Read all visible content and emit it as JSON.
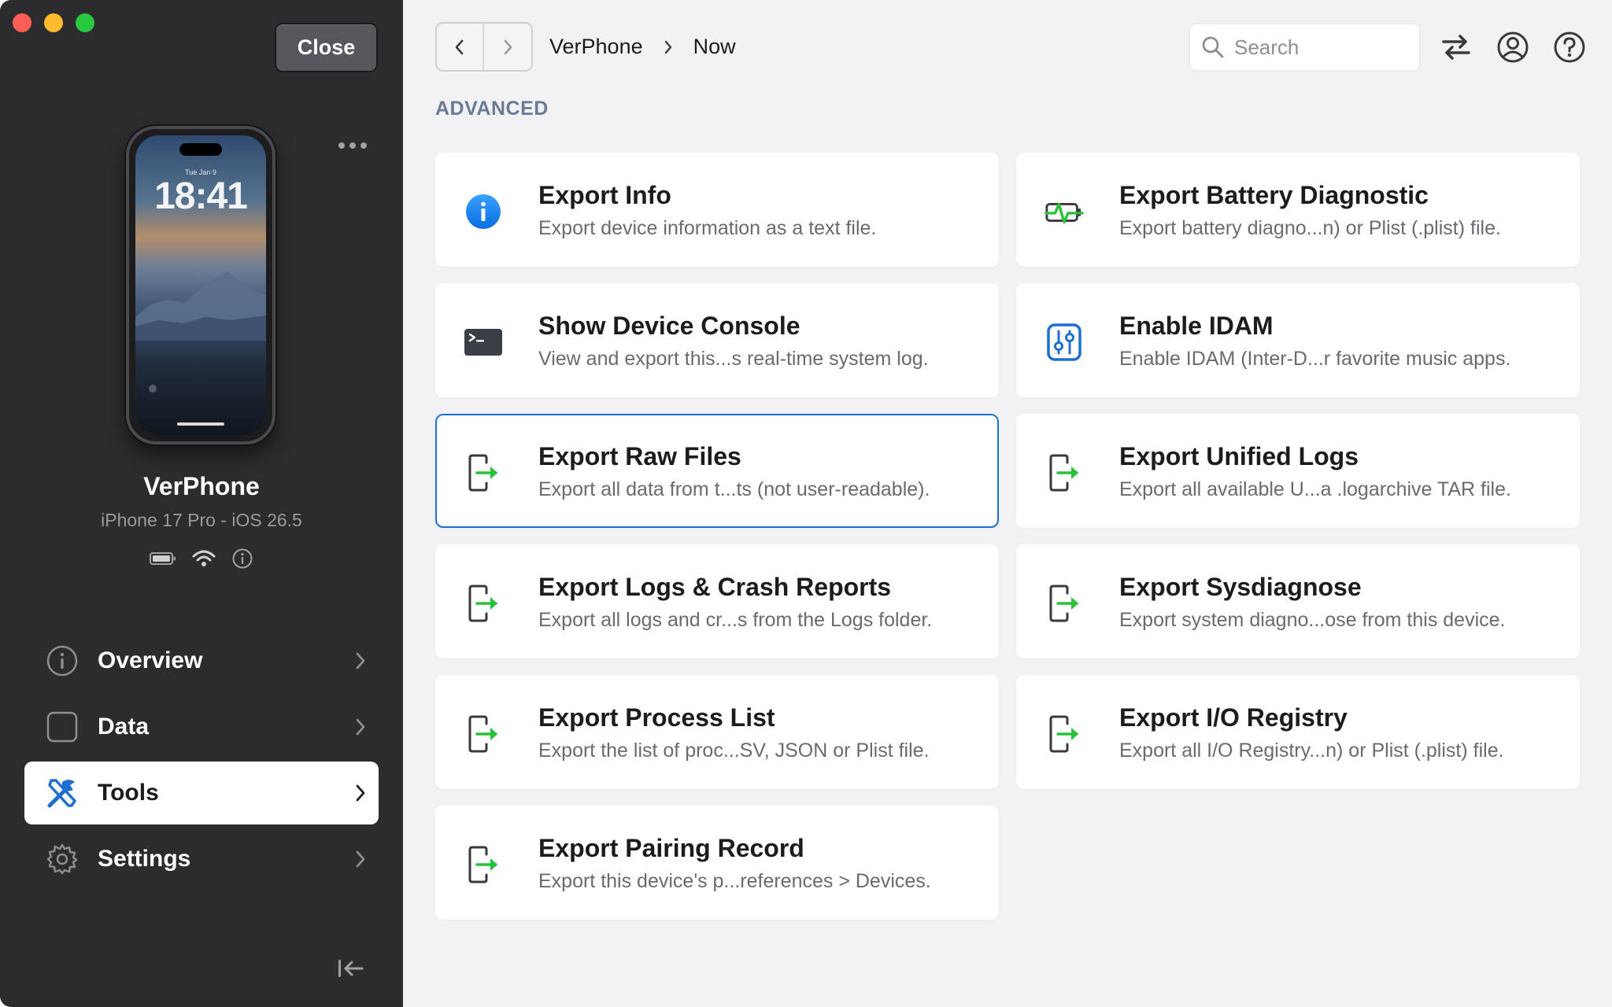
{
  "sidebar": {
    "close_label": "Close",
    "device": {
      "lock_date": "Tue Jan 9",
      "lock_time": "18:41",
      "name": "VerPhone",
      "model": "iPhone 17 Pro - iOS 26.5"
    },
    "nav": [
      {
        "label": "Overview",
        "icon": "info-circle-icon"
      },
      {
        "label": "Data",
        "icon": "square-icon"
      },
      {
        "label": "Tools",
        "icon": "tools-icon",
        "active": true
      },
      {
        "label": "Settings",
        "icon": "gear-icon"
      }
    ]
  },
  "header": {
    "breadcrumb": [
      "VerPhone",
      "Now"
    ],
    "search_placeholder": "Search"
  },
  "main": {
    "section_title": "ADVANCED",
    "cards": [
      {
        "title": "Export Info",
        "desc": "Export device information as a text file.",
        "icon": "info-icon"
      },
      {
        "title": "Export Battery Diagnostic",
        "desc": "Export battery diagno...n) or Plist (.plist) file.",
        "icon": "battery-pulse-icon"
      },
      {
        "title": "Show Device Console",
        "desc": "View and export this...s real-time system log.",
        "icon": "terminal-icon"
      },
      {
        "title": "Enable IDAM",
        "desc": "Enable IDAM (Inter-D...r favorite music apps.",
        "icon": "sliders-icon"
      },
      {
        "title": "Export Raw Files",
        "desc": "Export all data from t...ts (not user-readable).",
        "icon": "export-icon",
        "selected": true
      },
      {
        "title": "Export Unified Logs",
        "desc": "Export all available U...a .logarchive TAR file.",
        "icon": "export-icon"
      },
      {
        "title": "Export Logs & Crash Reports",
        "desc": "Export all logs and cr...s from the Logs folder.",
        "icon": "export-icon"
      },
      {
        "title": "Export Sysdiagnose",
        "desc": "Export system diagno...ose from this device.",
        "icon": "export-icon"
      },
      {
        "title": "Export Process List",
        "desc": "Export the list of proc...SV, JSON or Plist file.",
        "icon": "export-icon"
      },
      {
        "title": "Export I/O Registry",
        "desc": "Export all I/O Registry...n) or Plist (.plist) file.",
        "icon": "export-icon"
      },
      {
        "title": "Export Pairing Record",
        "desc": "Export this device's p...references > Devices.",
        "icon": "export-icon"
      }
    ]
  },
  "colors": {
    "sidebar_bg": "#2c2c2e",
    "main_bg": "#f2f2f4",
    "accent": "#1f6fd1",
    "export_green": "#2ac13a",
    "section_title": "#6b7a94"
  }
}
